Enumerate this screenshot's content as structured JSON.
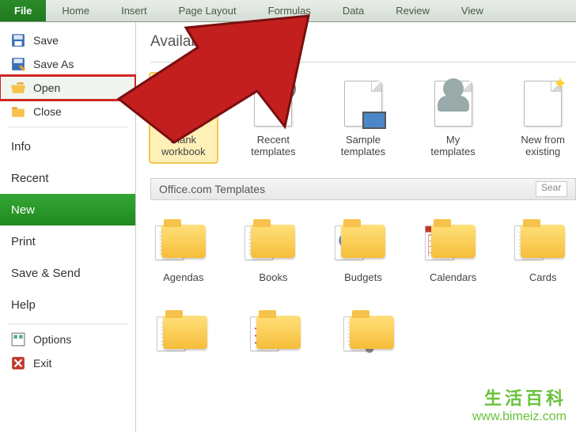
{
  "ribbon": {
    "tabs": [
      "File",
      "Home",
      "Insert",
      "Page Layout",
      "Formulas",
      "Data",
      "Review",
      "View"
    ]
  },
  "sidebar": {
    "save": "Save",
    "save_as": "Save As",
    "open": "Open",
    "close": "Close",
    "info": "Info",
    "recent": "Recent",
    "new": "New",
    "print": "Print",
    "save_send": "Save & Send",
    "help": "Help",
    "options": "Options",
    "exit": "Exit"
  },
  "content": {
    "title": "Available Templates",
    "office_title": "Office.com Templates",
    "search_placeholder": "Sear",
    "row1": [
      {
        "label": "Blank workbook"
      },
      {
        "label": "Recent templates"
      },
      {
        "label": "Sample templates"
      },
      {
        "label": "My templates"
      },
      {
        "label": "New from existing"
      }
    ],
    "row2": [
      {
        "label": "Agendas"
      },
      {
        "label": "Books"
      },
      {
        "label": "Budgets"
      },
      {
        "label": "Calendars"
      },
      {
        "label": "Cards"
      }
    ]
  },
  "watermark": {
    "cn": "生活百科",
    "url": "www.bimeiz.com"
  }
}
